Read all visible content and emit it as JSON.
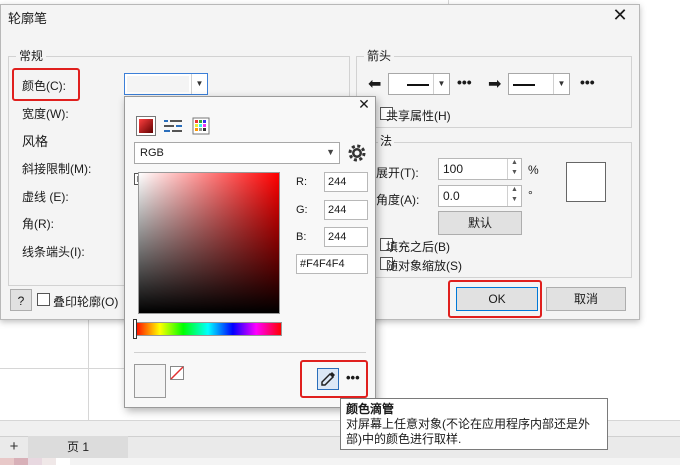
{
  "dialog": {
    "title": "轮廓笔",
    "left_group": "常规",
    "labels": {
      "color": "颜色(C):",
      "width": "宽度(W):",
      "style": "风格",
      "miter": "斜接限制(M):",
      "dash": "虚线 (E):",
      "corner": "角(R):",
      "linecap": "线条端头(I):"
    },
    "arrow_group": "箭头",
    "shared_attr": "共享属性(H)",
    "calligraphy_group": "法",
    "stretch_label": "展开(T):",
    "stretch_value": "100",
    "stretch_unit": "%",
    "angle_label": "角度(A):",
    "angle_value": "0.0",
    "angle_unit": "°",
    "default_button": "默认",
    "fill_behind": "填充之后(B)",
    "scale_with_object": "随对象缩放(S)",
    "help_button": "?",
    "overprint": "叠印轮廓(O)",
    "ok_button": "OK",
    "cancel_button": "取消"
  },
  "color_picker": {
    "model": "RGB",
    "r_label": "R:",
    "g_label": "G:",
    "b_label": "B:",
    "r_value": "244",
    "g_value": "244",
    "b_value": "244",
    "hex_value": "#F4F4F4",
    "current_color": "#f4f4f4",
    "accent_red": "#e0201e"
  },
  "tooltip": {
    "title": "颜色滴管",
    "body": "对屏幕上任意对象(不论在应用程序内部还是外部)中的颜色进行取样."
  },
  "page_tab": {
    "add": "+",
    "label": "页 1"
  }
}
